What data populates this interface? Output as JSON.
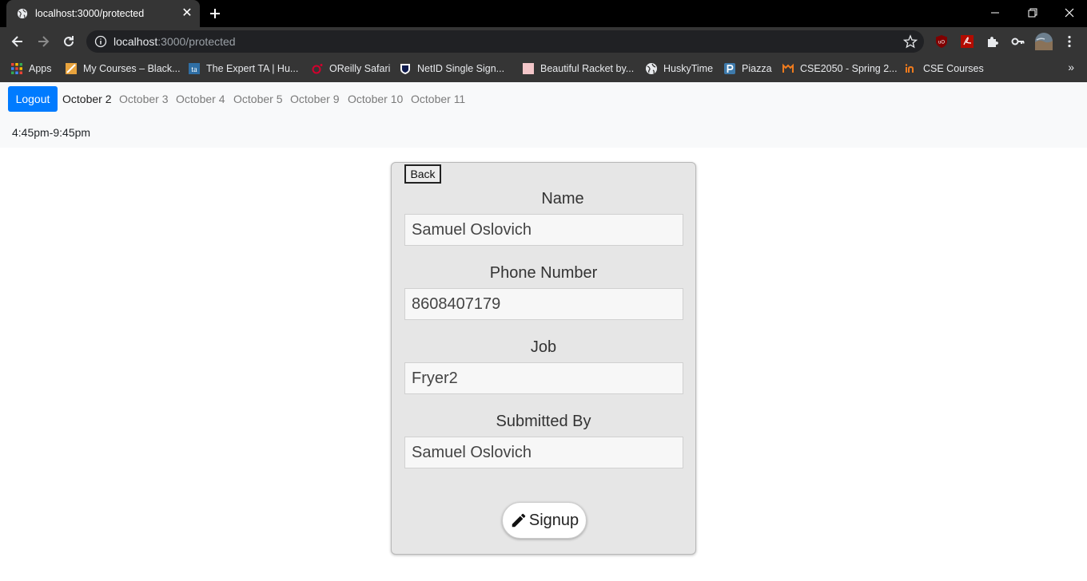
{
  "browser": {
    "tab_title": "localhost:3000/protected",
    "url_host": "localhost",
    "url_path": ":3000/protected",
    "bookmarks": [
      {
        "label": "Apps",
        "icon": "apps-grid-icon"
      },
      {
        "label": "My Courses – Black...",
        "icon": "blackboard-icon"
      },
      {
        "label": "The Expert TA | Hu...",
        "icon": "expert-ta-icon"
      },
      {
        "label": "OReilly Safari",
        "icon": "oreilly-icon"
      },
      {
        "label": "NetID Single Sign...",
        "icon": "netid-icon"
      },
      {
        "label": "Beautiful Racket by...",
        "icon": "racket-icon"
      },
      {
        "label": "HuskyTime",
        "icon": "globe-icon"
      },
      {
        "label": "Piazza",
        "icon": "piazza-icon"
      },
      {
        "label": "CSE2050 - Spring 2...",
        "icon": "mindtap-icon"
      },
      {
        "label": "CSE Courses",
        "icon": "cse-icon"
      }
    ]
  },
  "nav": {
    "logout_label": "Logout",
    "dates": [
      "October 2",
      "October 3",
      "October 4",
      "October 5",
      "October 9",
      "October 10",
      "October 11"
    ],
    "active_date": "October 2",
    "shift_time": "4:45pm-9:45pm"
  },
  "form": {
    "back_label": "Back",
    "fields": [
      {
        "label": "Name",
        "value": "Samuel Oslovich"
      },
      {
        "label": "Phone Number",
        "value": "8608407179"
      },
      {
        "label": "Job",
        "value": "Fryer2"
      },
      {
        "label": "Submitted By",
        "value": "Samuel Oslovich"
      }
    ],
    "submit_label": "Signup",
    "submit_icon": "pencil-icon"
  },
  "colors": {
    "logout_bg": "#007bff",
    "card_bg": "#e6e6e6"
  }
}
